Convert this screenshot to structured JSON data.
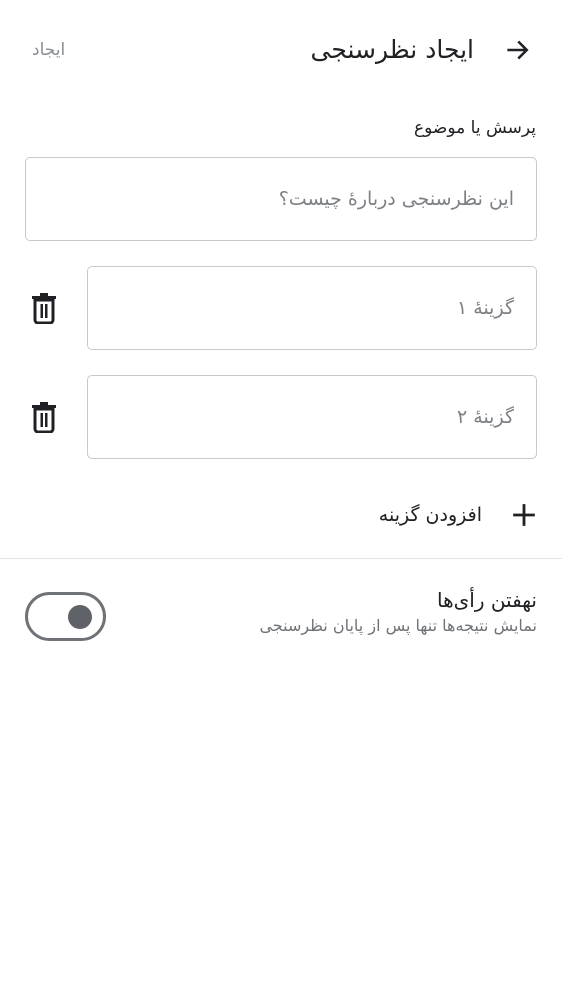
{
  "header": {
    "title": "ایجاد نظرسنجی",
    "create_label": "ایجاد",
    "back_icon": "arrow-right-icon"
  },
  "question": {
    "label": "پرسش یا موضوع",
    "placeholder": "این نظرسنجی دربارهٔ چیست؟",
    "value": ""
  },
  "options": [
    {
      "placeholder": "گزینهٔ ۱",
      "value": "",
      "delete_icon": "trash-icon"
    },
    {
      "placeholder": "گزینهٔ ۲",
      "value": "",
      "delete_icon": "trash-icon"
    }
  ],
  "add_option": {
    "label": "افزودن گزینه",
    "icon": "plus-icon"
  },
  "hide_votes": {
    "title": "نهفتن رأی‌ها",
    "subtitle": "نمایش نتیجه‌ها تنها پس از پایان نظرسنجی",
    "enabled": false
  },
  "colors": {
    "text": "#202124",
    "muted": "#8a8d91",
    "border": "#c7c9cc",
    "toggle": "#5f6368"
  }
}
